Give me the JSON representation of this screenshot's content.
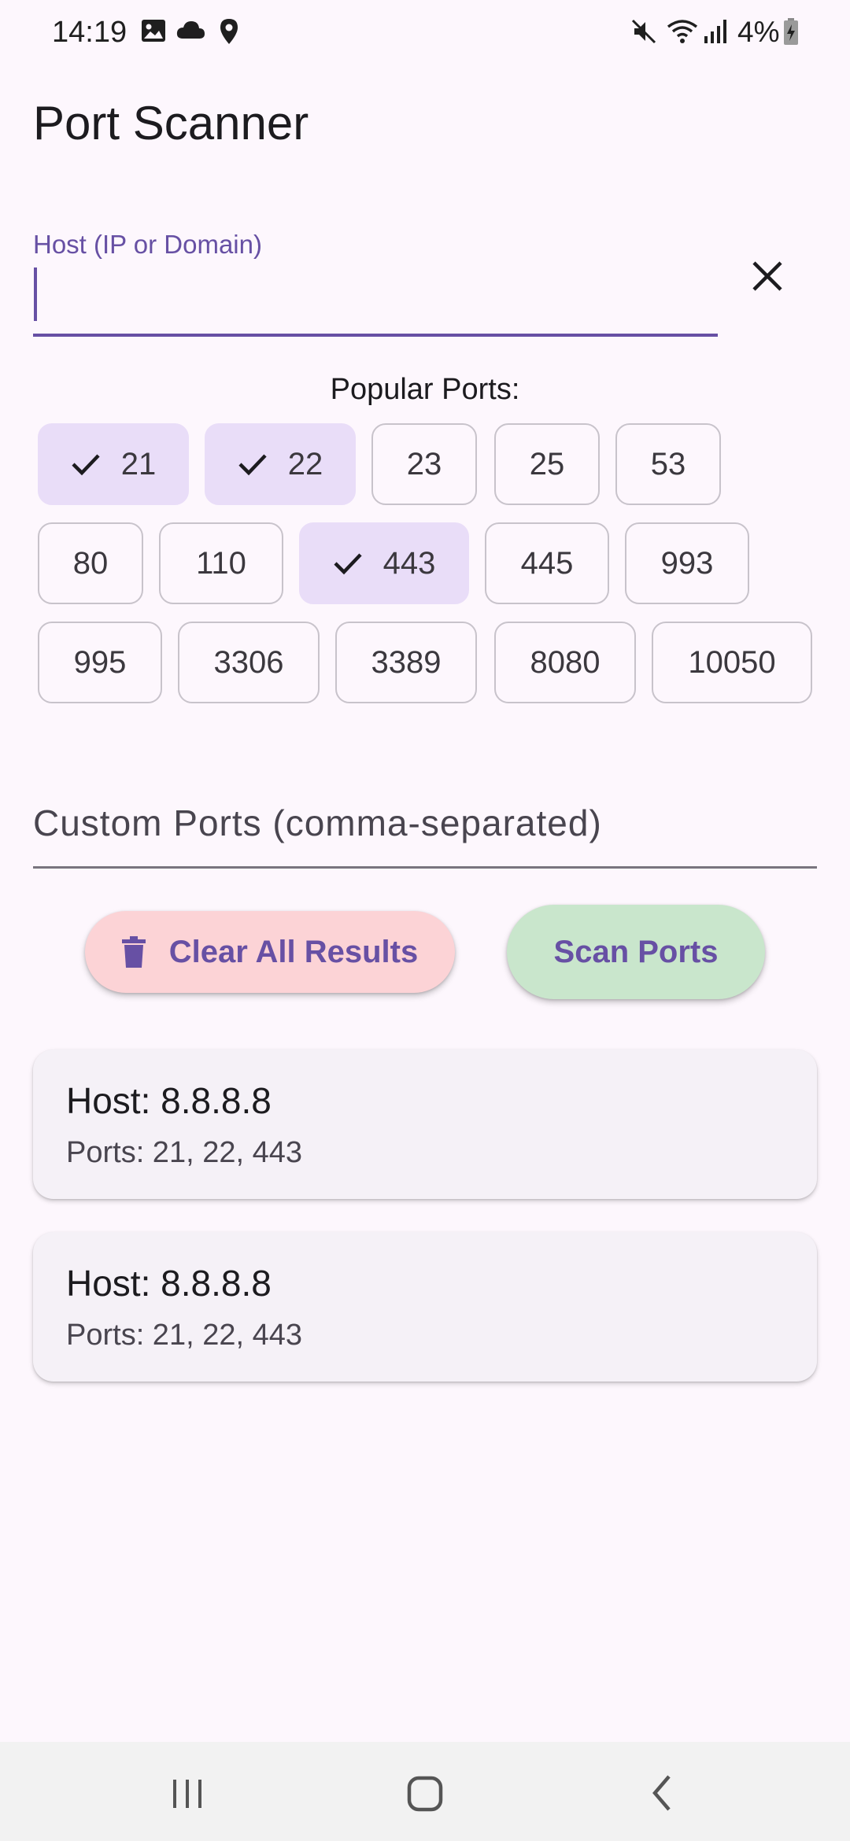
{
  "status_bar": {
    "time": "14:19",
    "battery": "4%",
    "icons": [
      "image-icon",
      "cloud-icon",
      "location-icon",
      "mute-icon",
      "wifi-icon",
      "signal-icon",
      "battery-charging-icon"
    ]
  },
  "app": {
    "title": "Port Scanner"
  },
  "host_field": {
    "label": "Host (IP or Domain)",
    "value": "",
    "clear_icon": "close-icon"
  },
  "popular_ports": {
    "label": "Popular Ports:",
    "chips": [
      {
        "label": "21",
        "selected": true
      },
      {
        "label": "22",
        "selected": true
      },
      {
        "label": "23",
        "selected": false
      },
      {
        "label": "25",
        "selected": false
      },
      {
        "label": "53",
        "selected": false
      },
      {
        "label": "80",
        "selected": false
      },
      {
        "label": "110",
        "selected": false
      },
      {
        "label": "443",
        "selected": true
      },
      {
        "label": "445",
        "selected": false
      },
      {
        "label": "993",
        "selected": false
      },
      {
        "label": "995",
        "selected": false
      },
      {
        "label": "3306",
        "selected": false
      },
      {
        "label": "3389",
        "selected": false
      },
      {
        "label": "8080",
        "selected": false
      },
      {
        "label": "10050",
        "selected": false
      }
    ]
  },
  "custom_ports": {
    "placeholder": "Custom Ports (comma-separated)",
    "value": ""
  },
  "actions": {
    "clear_all_label": "Clear All Results",
    "scan_label": "Scan Ports"
  },
  "results": [
    {
      "host": "Host: 8.8.8.8",
      "ports": "Ports: 21, 22, 443"
    },
    {
      "host": "Host: 8.8.8.8",
      "ports": "Ports: 21, 22, 443"
    }
  ],
  "colors": {
    "primary": "#6750a4",
    "background": "#fdf7fd",
    "chip_selected": "#e9ddf8",
    "clear_button": "#fcd3d6",
    "scan_button": "#c9e6cc",
    "card": "#f5f1f7"
  },
  "nav_bar": {
    "buttons": [
      "recent-apps-icon",
      "home-icon",
      "back-icon"
    ]
  }
}
